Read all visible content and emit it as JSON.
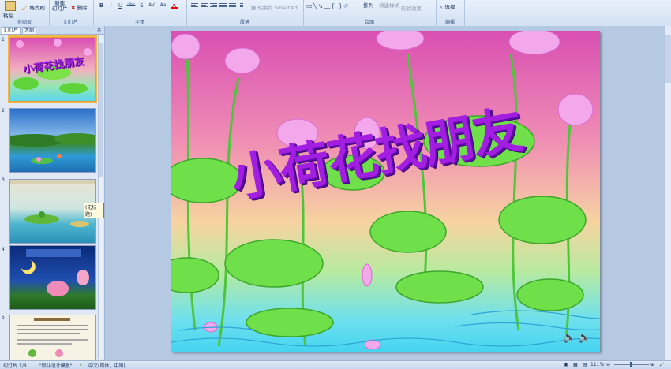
{
  "ribbon": {
    "clipboard": {
      "paste": "粘贴",
      "format_painter": "格式刷",
      "label": "剪贴板"
    },
    "slides": {
      "new_slide": "新建\n幻灯片",
      "delete": "删除",
      "label": "幻灯片"
    },
    "font": {
      "label": "字体",
      "bold": "B",
      "italic": "I",
      "underline": "U",
      "strike": "abc",
      "shadow": "S",
      "spacing": "AV",
      "case": "Aa",
      "color": "A"
    },
    "paragraph": {
      "label": "段落",
      "smartart": "转换为 SmartArt"
    },
    "drawing": {
      "label": "绘图",
      "arrange": "排列",
      "quick_styles": "快速样式",
      "shape_effects": "形状效果"
    },
    "editing": {
      "label": "编辑",
      "select": "选择"
    }
  },
  "left_pane": {
    "tabs": [
      "幻灯片",
      "大纲"
    ],
    "close_glyph": "×",
    "thumbnail_numbers": [
      "1",
      "2",
      "3",
      "4",
      "5"
    ],
    "thumb1_title": "小荷花找朋友",
    "tooltip": "(无标题)"
  },
  "slide": {
    "title": "小荷花找朋友",
    "speaker_glyphs": [
      "🔈",
      "🔈"
    ]
  },
  "status_bar": {
    "slide_index": "幻灯片 1/8",
    "theme": "\"默认设计模板\"",
    "language": "中文(简体，中国)",
    "zoom": "111%"
  },
  "colors": {
    "ribbon_bg": "#d2e1f4",
    "selection": "#f4b648",
    "title_purple": "#a21ee0"
  }
}
